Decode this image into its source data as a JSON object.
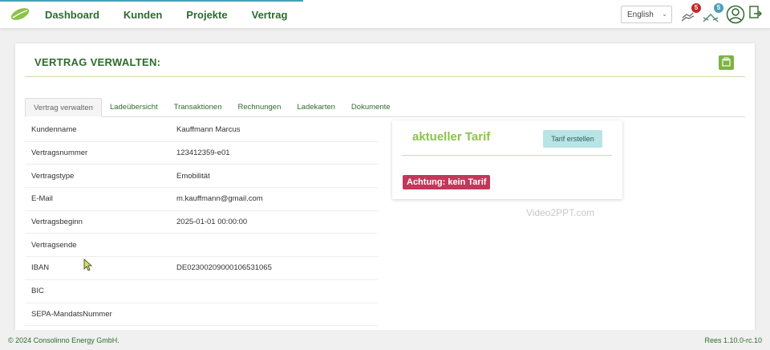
{
  "nav": {
    "items": [
      "Dashboard",
      "Kunden",
      "Projekte",
      "Vertrag"
    ]
  },
  "header": {
    "language": "English",
    "badge_one": "5",
    "badge_two": "5"
  },
  "page": {
    "title": "VERTRAG VERWALTEN:"
  },
  "tabs": [
    "Vertrag verwalten",
    "Ladeübersicht",
    "Transaktionen",
    "Rechnungen",
    "Ladekarten",
    "Dokumente"
  ],
  "contract": [
    {
      "label": "Kundenname",
      "value": "Kauffmann Marcus"
    },
    {
      "label": "Vertragsnummer",
      "value": "123412359-e01"
    },
    {
      "label": "Vertragstype",
      "value": "Emobilität"
    },
    {
      "label": "E-Mail",
      "value": "m.kauffmann@gmail.com"
    },
    {
      "label": "Vertragsbeginn",
      "value": "2025-01-01 00:00:00"
    },
    {
      "label": "Vertragsende",
      "value": ""
    },
    {
      "label": "IBAN",
      "value": "DE02300209000106531065"
    },
    {
      "label": "BIC",
      "value": ""
    },
    {
      "label": "SEPA-MandatsNummer",
      "value": ""
    }
  ],
  "tarif": {
    "title": "aktueller Tarif",
    "button": "Tarif erstellen",
    "warning": "Achtung: kein Tarif"
  },
  "watermark": "Video2PPT.com",
  "footer": {
    "copyright": "© 2024 Consolinno Energy GmbH.",
    "version": "Rees 1.10.0-rc.10"
  },
  "colors": {
    "primary": "#2e6b2e",
    "accent": "#8bc34a",
    "warning": "#c2385a",
    "badge_red": "#c62828",
    "badge_teal": "#4a9fb8"
  }
}
